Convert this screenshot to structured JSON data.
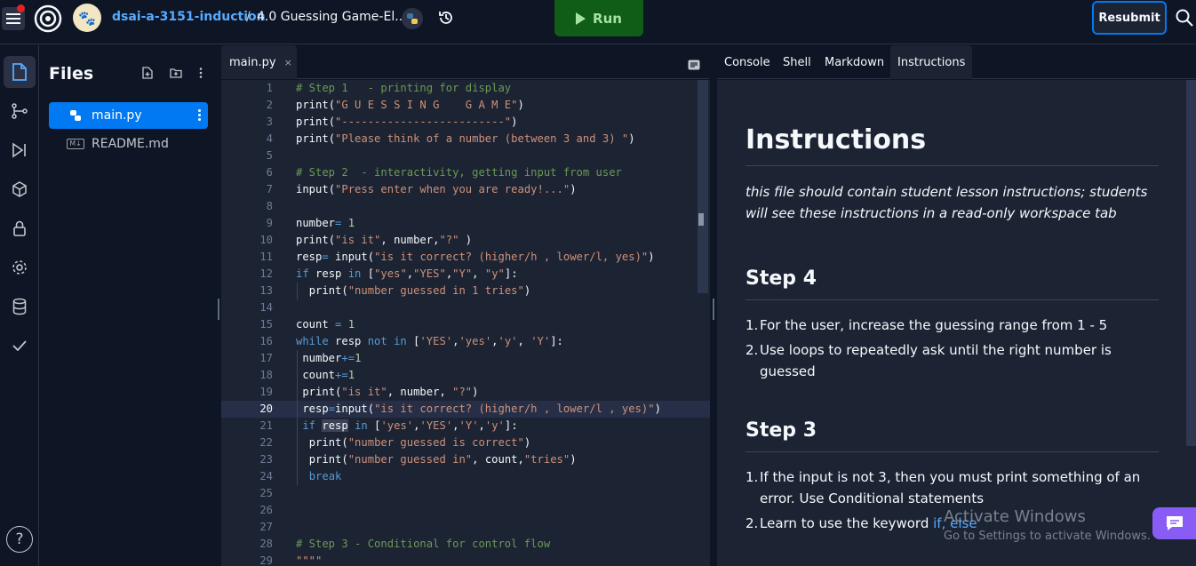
{
  "topbar": {
    "repo_name": "dsai-a-3151-induction",
    "separator": "/",
    "project_title": "4.0 Guessing Game-El...",
    "run_label": "Run",
    "resubmit_label": "Resubmit"
  },
  "files_panel": {
    "title": "Files",
    "items": [
      {
        "name": "main.py",
        "icon": "python-icon",
        "selected": true
      },
      {
        "name": "README.md",
        "icon": "markdown-icon",
        "selected": false
      }
    ]
  },
  "editor": {
    "tab_label": "main.py",
    "tab_close": "×",
    "current_line": 20,
    "lines": [
      {
        "n": "1",
        "html": "<span class='c-com'># Step 1   - printing for display</span>"
      },
      {
        "n": "2",
        "html": "<span class='c-fn'>print</span>(<span class='c-str'>\"G U E S S I N G    G A M E\"</span>)"
      },
      {
        "n": "3",
        "html": "<span class='c-fn'>print</span>(<span class='c-str'>\"-------------------------\"</span>)"
      },
      {
        "n": "4",
        "html": "<span class='c-fn'>print</span>(<span class='c-str'>\"Please think of a number (between 3 and 3) \"</span>)"
      },
      {
        "n": "5",
        "html": ""
      },
      {
        "n": "6",
        "html": "<span class='c-com'># Step 2  - interactivity, getting input from user</span>"
      },
      {
        "n": "7",
        "html": "<span class='c-fn'>input</span>(<span class='c-str'>\"Press enter when you are ready!...\"</span>)"
      },
      {
        "n": "8",
        "html": ""
      },
      {
        "n": "9",
        "html": "number<span class='c-op'>=</span> <span class='c-num'>1</span>"
      },
      {
        "n": "10",
        "html": "<span class='c-fn'>print</span>(<span class='c-str'>\"is it\"</span>, number,<span class='c-str'>\"?\"</span> )"
      },
      {
        "n": "11",
        "html": "resp<span class='c-op'>=</span> <span class='c-fn'>input</span>(<span class='c-str'>\"is it correct? (higher/h , lower/l, yes)\"</span>)"
      },
      {
        "n": "12",
        "html": "<span class='c-kw'>if</span> resp <span class='c-kw'>in</span> [<span class='c-str'>\"yes\"</span>,<span class='c-str'>\"YES\"</span>,<span class='c-str'>\"Y\"</span>, <span class='c-str'>\"y\"</span>]:"
      },
      {
        "n": "13",
        "html": "  <span class='c-fn'>print</span>(<span class='c-str'>\"number guessed in 1 tries\"</span>)"
      },
      {
        "n": "14",
        "html": ""
      },
      {
        "n": "15",
        "html": "count <span class='c-op'>=</span> <span class='c-num'>1</span>"
      },
      {
        "n": "16",
        "html": "<span class='c-kw'>while</span> resp <span class='c-kw'>not in</span> [<span class='c-str'>'YES'</span>,<span class='c-str'>'yes'</span>,<span class='c-str'>'y'</span>, <span class='c-str'>'Y'</span>]:"
      },
      {
        "n": "17",
        "html": " number<span class='c-op'>+=</span><span class='c-num'>1</span>"
      },
      {
        "n": "18",
        "html": " count<span class='c-op'>+=</span><span class='c-num'>1</span>"
      },
      {
        "n": "19",
        "html": " <span class='c-fn'>print</span>(<span class='c-str'>\"is it\"</span>, number, <span class='c-str'>\"?\"</span>)"
      },
      {
        "n": "20",
        "html": " resp<span class='c-op'>=</span><span class='c-fn'>input</span>(<span class='c-str'>\"is it correct? (higher/h , lower/l , yes)\"</span>)"
      },
      {
        "n": "21",
        "html": " <span class='c-kw'>if</span> <span class='c-hl'>resp</span> <span class='c-kw'>in</span> [<span class='c-str'>'yes'</span>,<span class='c-str'>'YES'</span>,<span class='c-str'>'Y'</span>,<span class='c-str'>'y'</span>]:"
      },
      {
        "n": "22",
        "html": "  <span class='c-fn'>print</span>(<span class='c-str'>\"number guessed is correct\"</span>)"
      },
      {
        "n": "23",
        "html": "  <span class='c-fn'>print</span>(<span class='c-str'>\"number guessed in\"</span>, count,<span class='c-str'>\"tries\"</span>)"
      },
      {
        "n": "24",
        "html": "  <span class='c-kw'>break</span>"
      },
      {
        "n": "25",
        "html": ""
      },
      {
        "n": "26",
        "html": ""
      },
      {
        "n": "27",
        "html": ""
      },
      {
        "n": "28",
        "html": "<span class='c-com'># Step 3 - Conditional for control flow</span>"
      },
      {
        "n": "29",
        "html": "<span class='c-str'>\"\"\"\"</span>"
      }
    ]
  },
  "right_panel": {
    "tabs": [
      "Console",
      "Shell",
      "Markdown",
      "Instructions"
    ],
    "active_tab": "Instructions",
    "heading": "Instructions",
    "intro": "this file should contain student lesson instructions; students will see these instructions in a read-only workspace tab",
    "step4": {
      "title": "Step 4",
      "items": [
        "For the user, increase the guessing range from 1 - 5",
        "Use loops to repeatedly ask until the right number is guessed"
      ]
    },
    "step3": {
      "title": "Step 3",
      "item1": "If the input is not 3, then you must print something of an error. Use Conditional statements",
      "item2_prefix": "Learn to use the keyword ",
      "item2_keyword": "if, else"
    }
  },
  "overlay": {
    "watermark_title": "Activate Windows",
    "watermark_sub": "Go to Settings to activate Windows."
  },
  "colors": {
    "accent": "#0079f2",
    "run_bg": "#0f5d16",
    "run_fg": "#a6e3a1",
    "link": "#57abff",
    "chat": "#8a5cf6"
  }
}
